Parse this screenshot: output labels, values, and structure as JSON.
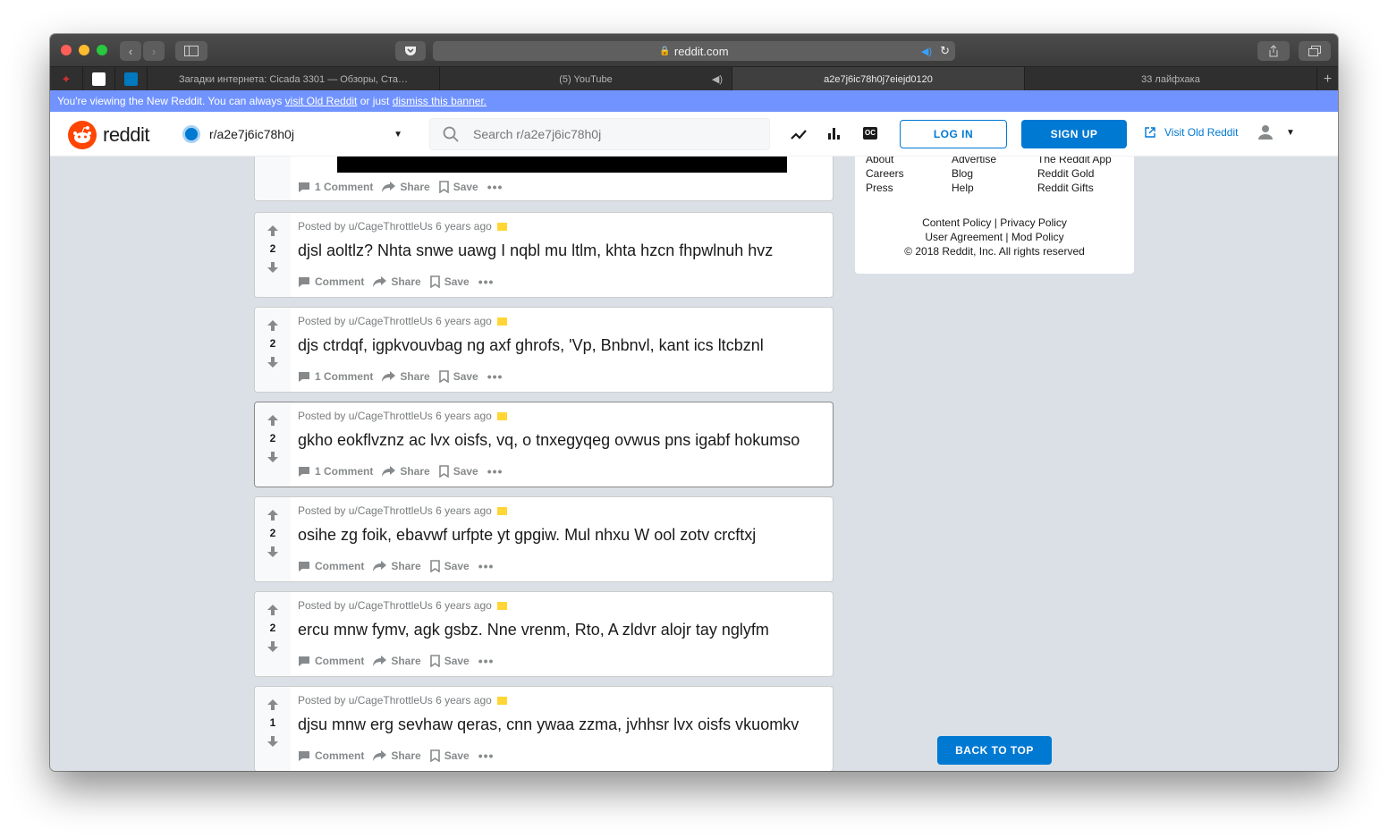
{
  "browser": {
    "url": "reddit.com",
    "tabs": [
      "Загадки интернета: Cicada 3301 — Обзоры, Ста…",
      "(5) YouTube",
      "a2e7j6ic78h0j7eiejd0120",
      "33 лайфхака"
    ]
  },
  "banner": {
    "text_before": "You're viewing the New Reddit. You can always ",
    "link_old": "visit Old Reddit",
    "text_middle": " or just ",
    "link_dismiss": "dismiss this banner."
  },
  "header": {
    "logo_text": "reddit",
    "community": "r/a2e7j6ic78h0j",
    "search_placeholder": "Search r/a2e7j6ic78h0j",
    "login_label": "LOG IN",
    "signup_label": "SIGN UP",
    "visit_old": "Visit Old Reddit"
  },
  "partial_post": {
    "comments": "1 Comment",
    "share": "Share",
    "save": "Save"
  },
  "posts": [
    {
      "meta": "Posted by u/CageThrottleUs 6 years ago",
      "score": "2",
      "title": "djsl aoltlz? Nhta snwe uawg I nqbl mu ltlm, khta hzcn fhpwlnuh hvz",
      "comments": "Comment",
      "share": "Share",
      "save": "Save"
    },
    {
      "meta": "Posted by u/CageThrottleUs 6 years ago",
      "score": "2",
      "title": "djs ctrdqf, igpkvouvbag ng axf ghrofs, 'Vp, Bnbnvl, kant ics ltcbznl",
      "comments": "1 Comment",
      "share": "Share",
      "save": "Save"
    },
    {
      "meta": "Posted by u/CageThrottleUs 6 years ago",
      "score": "2",
      "title": "gkho eokflvznz ac lvx oisfs, vq, o tnxegyqeg ovwus pns igabf hokumso",
      "comments": "1 Comment",
      "share": "Share",
      "save": "Save"
    },
    {
      "meta": "Posted by u/CageThrottleUs 6 years ago",
      "score": "2",
      "title": "osihe zg foik, ebavwf urfpte yt gpgiw. Mul nhxu W ool zotv crcftxj",
      "comments": "Comment",
      "share": "Share",
      "save": "Save"
    },
    {
      "meta": "Posted by u/CageThrottleUs 6 years ago",
      "score": "2",
      "title": "ercu mnw fymv, agk gsbz. Nne vrenm, Rto, A zldvr alojr tay nglyfm",
      "comments": "Comment",
      "share": "Share",
      "save": "Save"
    },
    {
      "meta": "Posted by u/CageThrottleUs 6 years ago",
      "score": "1",
      "title": "djsu mnw erg sevhaw qeras, cnn ywaa zzma, jvhhsr lvx oisfs vkuomkv",
      "comments": "Comment",
      "share": "Share",
      "save": "Save"
    }
  ],
  "sidebar": {
    "col1": [
      "About",
      "Careers",
      "Press"
    ],
    "col2": [
      "Advertise",
      "Blog",
      "Help"
    ],
    "col3": [
      "The Reddit App",
      "Reddit Gold",
      "Reddit Gifts"
    ],
    "content_policy": "Content Policy |",
    "privacy_policy": "Privacy Policy",
    "user_agreement": "User Agreement |",
    "mod_policy": "Mod Policy",
    "copyright": "© 2018 Reddit, Inc. All rights reserved"
  },
  "back_to_top": "BACK TO TOP",
  "colors": {
    "reddit_orange": "#ff4500",
    "blue": "#0079d3",
    "banner": "#7193ff",
    "gold": "#ffd635"
  }
}
